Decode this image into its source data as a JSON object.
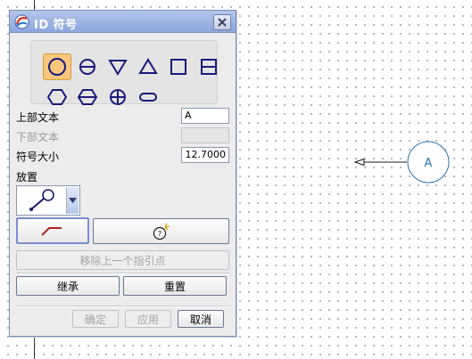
{
  "dialog": {
    "title": "ID 符号",
    "icons": {
      "app": "app-icon",
      "close": "close-icon"
    }
  },
  "symbols": [
    {
      "name": "circle-symbol",
      "selected": true
    },
    {
      "name": "circle-divided-symbol",
      "selected": false
    },
    {
      "name": "triangle-down-symbol",
      "selected": false
    },
    {
      "name": "triangle-up-symbol",
      "selected": false
    },
    {
      "name": "square-symbol",
      "selected": false
    },
    {
      "name": "square-divided-symbol",
      "selected": false
    },
    {
      "name": "hexagon-symbol",
      "selected": false
    },
    {
      "name": "hexagon-divided-symbol",
      "selected": false
    },
    {
      "name": "circle-cross-symbol",
      "selected": false
    },
    {
      "name": "slot-symbol",
      "selected": false
    }
  ],
  "fields": {
    "upper_text_label": "上部文本",
    "upper_text_value": "A",
    "lower_text_label": "下部文本",
    "lower_text_value": "",
    "symbol_size_label": "符号大小",
    "symbol_size_value": "12.7000"
  },
  "placement": {
    "label": "放置",
    "selected_icon": "leader-pin-icon"
  },
  "buttons": {
    "leader_icon": "leader-line-icon",
    "point_icon": "origin-point-icon",
    "remove_leader": "移除上一个指引点",
    "inherit": "继承",
    "reset": "重置",
    "ok": "确定",
    "apply": "应用",
    "cancel": "取消"
  },
  "canvas": {
    "balloon_text": "A"
  },
  "colors": {
    "accent": "#1a1a7a",
    "selected_bg": "#f8c77d",
    "balloon": "#2b73b4",
    "titlebar": "#9db3e3"
  }
}
